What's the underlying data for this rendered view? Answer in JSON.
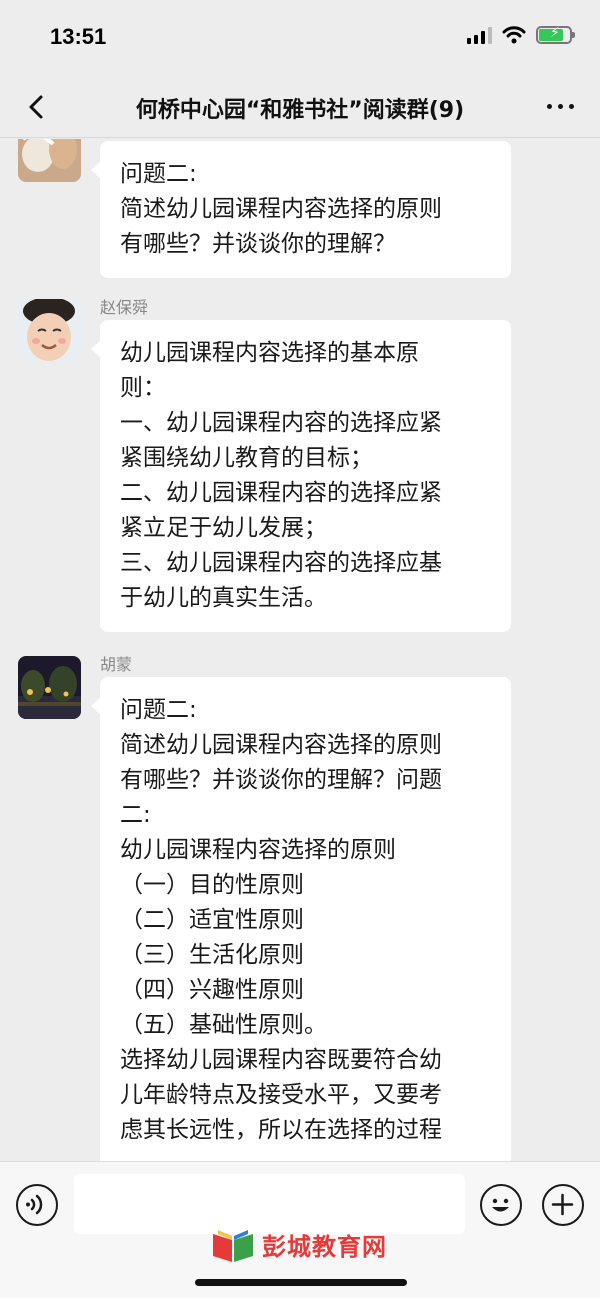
{
  "status_bar": {
    "time": "13:51",
    "battery_color": "#34c759"
  },
  "nav": {
    "title": "何桥中心园“和雅书社”阅读群(9)",
    "back_icon": "chevron-left-icon",
    "more_icon": "ellipsis-icon"
  },
  "messages": [
    {
      "sender": "",
      "lines": [
        "问题二:",
        "简述幼儿园课程内容选择的原则",
        "有哪些？并谈谈你的理解？"
      ]
    },
    {
      "sender": "赵保舜",
      "lines": [
        "幼儿园课程内容选择的基本原",
        "则：",
        "一、幼儿园课程内容的选择应紧",
        "紧围绕幼儿教育的目标；",
        "二、幼儿园课程内容的选择应紧",
        "紧立足于幼儿发展；",
        "三、幼儿园课程内容的选择应基",
        "于幼儿的真实生活。"
      ]
    },
    {
      "sender": "胡蒙",
      "lines": [
        "问题二:",
        "简述幼儿园课程内容选择的原则",
        "有哪些？并谈谈你的理解？问题",
        "二:",
        "幼儿园课程内容选择的原则",
        "（一）目的性原则",
        "（二）适宜性原则",
        "（三）生活化原则",
        "（四）兴趣性原则",
        "（五）基础性原则。",
        "选择幼儿园课程内容既要符合幼",
        "儿年龄特点及接受水平，又要考",
        "虑其长远性，所以在选择的过程"
      ]
    }
  ],
  "input_bar": {
    "voice_icon": "voice-icon",
    "emoji_icon": "emoji-icon",
    "plus_icon": "plus-icon"
  },
  "watermark": {
    "text": "彭城教育网"
  }
}
